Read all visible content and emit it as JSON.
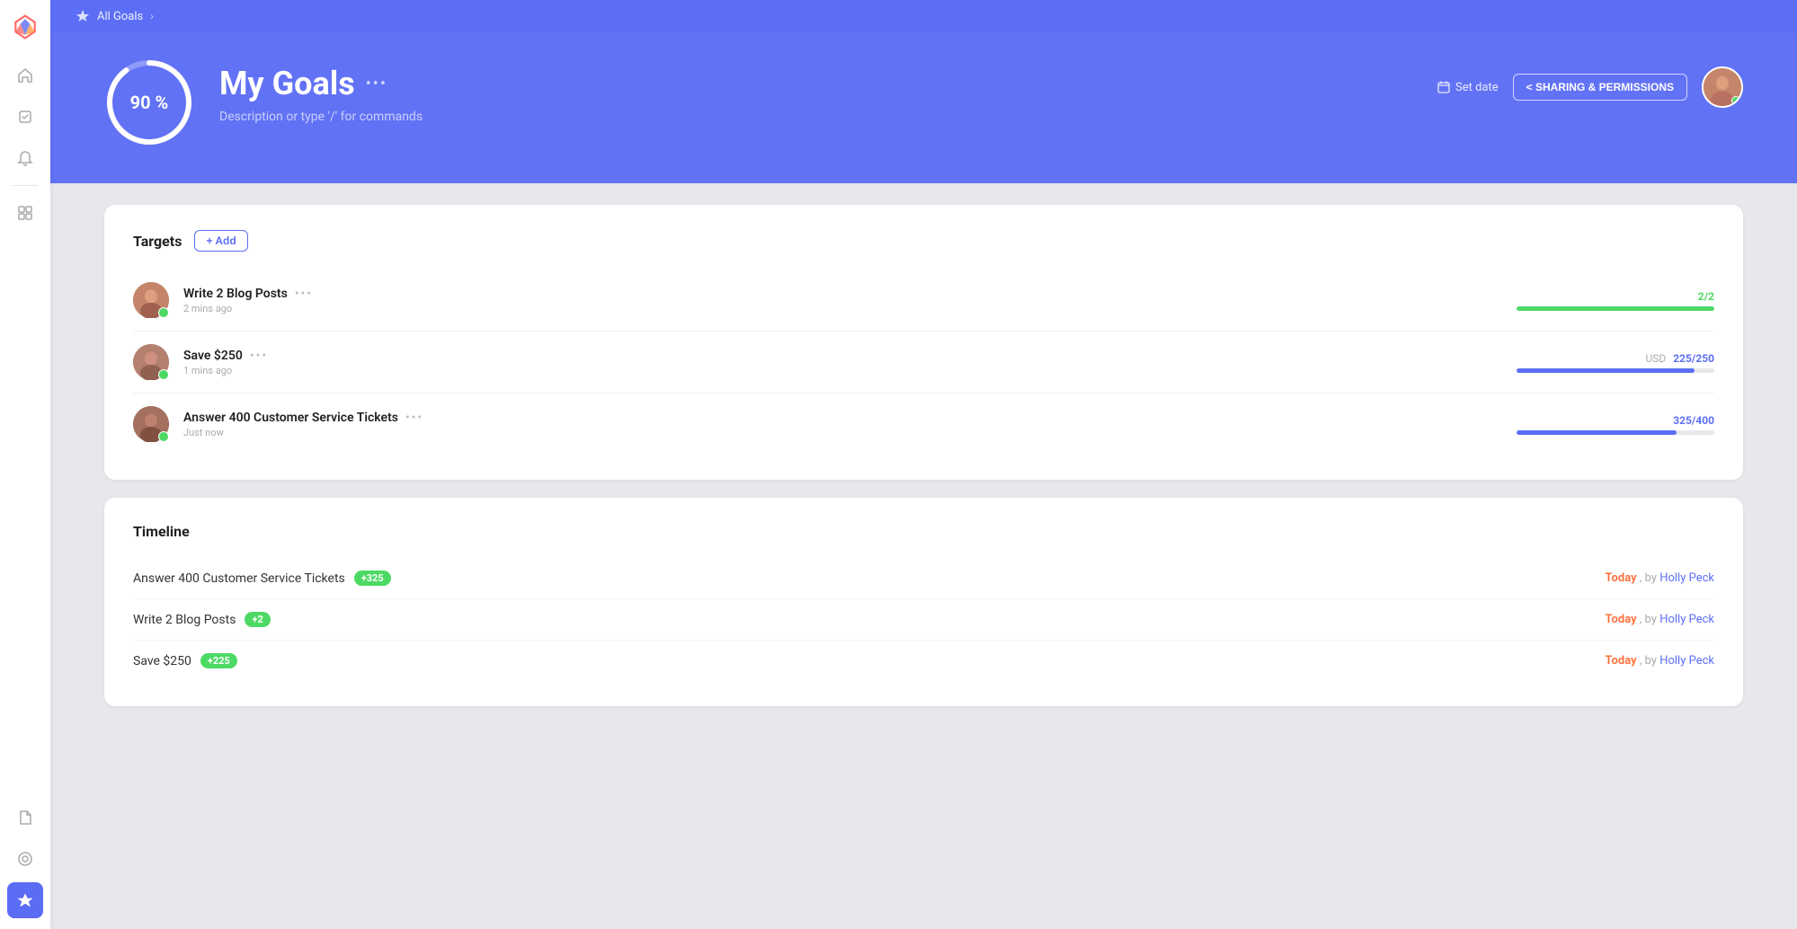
{
  "app": {
    "logo_char": "🎯"
  },
  "sidebar": {
    "items": [
      {
        "icon": "🏠",
        "name": "home",
        "label": "Home",
        "active": false
      },
      {
        "icon": "✓",
        "name": "tasks",
        "label": "Tasks",
        "active": false
      },
      {
        "icon": "🔔",
        "name": "notifications",
        "label": "Notifications",
        "active": false
      },
      {
        "icon": "⊞",
        "name": "dashboard",
        "label": "Dashboard",
        "active": false
      },
      {
        "icon": "📄",
        "name": "docs",
        "label": "Documents",
        "active": false
      },
      {
        "icon": "📡",
        "name": "pulse",
        "label": "Pulse",
        "active": false
      },
      {
        "icon": "🏆",
        "name": "goals",
        "label": "Goals",
        "active": true
      }
    ]
  },
  "breadcrumb": {
    "label": "All Goals",
    "icon": "trophy"
  },
  "header": {
    "progress_percent": "90 %",
    "progress_value": 90,
    "title": "My Goals",
    "menu_dots": "•••",
    "description": "Description or type '/' for commands",
    "set_date_label": "Set date",
    "sharing_label": "< SHARING & PERMISSIONS"
  },
  "targets": {
    "section_title": "Targets",
    "add_label": "+ Add",
    "items": [
      {
        "name": "Write 2 Blog Posts",
        "time": "2 mins ago",
        "dots": "•••",
        "progress_display": "2/2",
        "progress_fill_pct": 100,
        "bar_color": "green",
        "currency": ""
      },
      {
        "name": "Save $250",
        "time": "1 mins ago",
        "dots": "•••",
        "progress_display": "225/250",
        "progress_fill_pct": 90,
        "bar_color": "blue",
        "currency": "USD"
      },
      {
        "name": "Answer 400 Customer Service Tickets",
        "time": "Just now",
        "dots": "•••",
        "progress_display": "325/400",
        "progress_fill_pct": 81,
        "bar_color": "blue",
        "currency": ""
      }
    ]
  },
  "timeline": {
    "section_title": "Timeline",
    "items": [
      {
        "text": "Answer 400 Customer Service Tickets",
        "badge": "+325",
        "date": "Today",
        "by": ", by ",
        "author": "Holly Peck"
      },
      {
        "text": "Write 2 Blog Posts",
        "badge": "+2",
        "date": "Today",
        "by": ", by ",
        "author": "Holly Peck"
      },
      {
        "text": "Save $250",
        "badge": "+225",
        "date": "Today",
        "by": ", by ",
        "author": "Holly Peck"
      }
    ]
  }
}
